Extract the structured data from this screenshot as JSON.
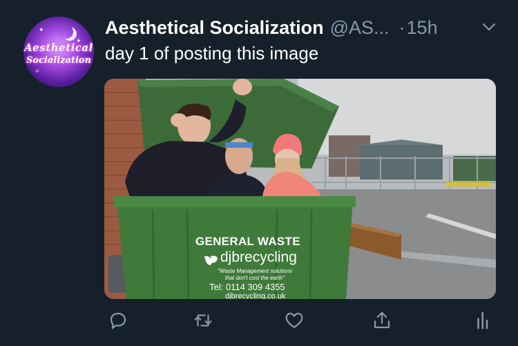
{
  "tweet": {
    "display_name": "Aesthetical Socialization",
    "handle": "@AS...",
    "separator": "·",
    "timestamp": "15h",
    "text": "day 1 of posting this image"
  },
  "avatar": {
    "line1": "Aesthetical",
    "line2": "Socialization"
  },
  "media": {
    "bin_text": {
      "title": "GENERAL WASTE",
      "brand": "djbrecycling",
      "tagline": "\"Waste Management solutions that don't cost the earth\"",
      "tel": "Tel: 0114 309 4355",
      "url": "djbrecycling.co.uk"
    }
  },
  "actions": [
    "reply-icon",
    "retweet-icon",
    "like-icon",
    "share-icon",
    "analytics-icon"
  ],
  "colors": {
    "background": "#15202b",
    "secondary_text": "#8899a6",
    "icon": "#8899a6",
    "bin_green": "#3f7a3a"
  }
}
